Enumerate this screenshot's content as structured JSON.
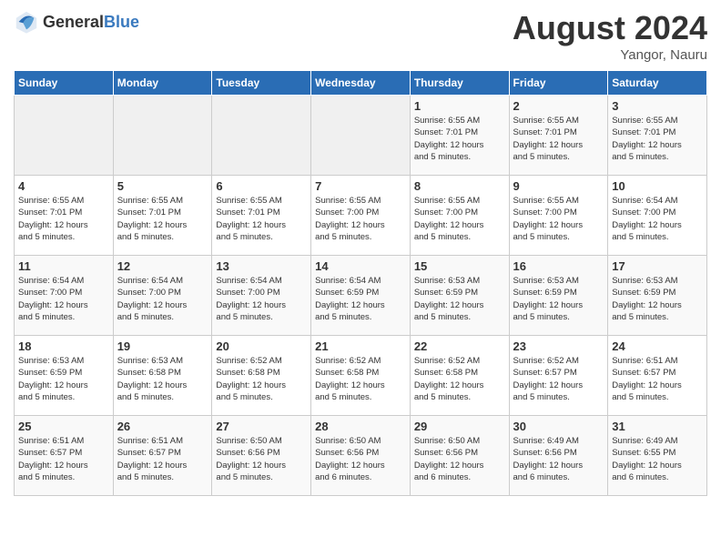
{
  "header": {
    "logo_general": "General",
    "logo_blue": "Blue",
    "month_year": "August 2024",
    "location": "Yangor, Nauru"
  },
  "weekdays": [
    "Sunday",
    "Monday",
    "Tuesday",
    "Wednesday",
    "Thursday",
    "Friday",
    "Saturday"
  ],
  "weeks": [
    [
      {
        "day": "",
        "info": ""
      },
      {
        "day": "",
        "info": ""
      },
      {
        "day": "",
        "info": ""
      },
      {
        "day": "",
        "info": ""
      },
      {
        "day": "1",
        "info": "Sunrise: 6:55 AM\nSunset: 7:01 PM\nDaylight: 12 hours\nand 5 minutes."
      },
      {
        "day": "2",
        "info": "Sunrise: 6:55 AM\nSunset: 7:01 PM\nDaylight: 12 hours\nand 5 minutes."
      },
      {
        "day": "3",
        "info": "Sunrise: 6:55 AM\nSunset: 7:01 PM\nDaylight: 12 hours\nand 5 minutes."
      }
    ],
    [
      {
        "day": "4",
        "info": "Sunrise: 6:55 AM\nSunset: 7:01 PM\nDaylight: 12 hours\nand 5 minutes."
      },
      {
        "day": "5",
        "info": "Sunrise: 6:55 AM\nSunset: 7:01 PM\nDaylight: 12 hours\nand 5 minutes."
      },
      {
        "day": "6",
        "info": "Sunrise: 6:55 AM\nSunset: 7:01 PM\nDaylight: 12 hours\nand 5 minutes."
      },
      {
        "day": "7",
        "info": "Sunrise: 6:55 AM\nSunset: 7:00 PM\nDaylight: 12 hours\nand 5 minutes."
      },
      {
        "day": "8",
        "info": "Sunrise: 6:55 AM\nSunset: 7:00 PM\nDaylight: 12 hours\nand 5 minutes."
      },
      {
        "day": "9",
        "info": "Sunrise: 6:55 AM\nSunset: 7:00 PM\nDaylight: 12 hours\nand 5 minutes."
      },
      {
        "day": "10",
        "info": "Sunrise: 6:54 AM\nSunset: 7:00 PM\nDaylight: 12 hours\nand 5 minutes."
      }
    ],
    [
      {
        "day": "11",
        "info": "Sunrise: 6:54 AM\nSunset: 7:00 PM\nDaylight: 12 hours\nand 5 minutes."
      },
      {
        "day": "12",
        "info": "Sunrise: 6:54 AM\nSunset: 7:00 PM\nDaylight: 12 hours\nand 5 minutes."
      },
      {
        "day": "13",
        "info": "Sunrise: 6:54 AM\nSunset: 7:00 PM\nDaylight: 12 hours\nand 5 minutes."
      },
      {
        "day": "14",
        "info": "Sunrise: 6:54 AM\nSunset: 6:59 PM\nDaylight: 12 hours\nand 5 minutes."
      },
      {
        "day": "15",
        "info": "Sunrise: 6:53 AM\nSunset: 6:59 PM\nDaylight: 12 hours\nand 5 minutes."
      },
      {
        "day": "16",
        "info": "Sunrise: 6:53 AM\nSunset: 6:59 PM\nDaylight: 12 hours\nand 5 minutes."
      },
      {
        "day": "17",
        "info": "Sunrise: 6:53 AM\nSunset: 6:59 PM\nDaylight: 12 hours\nand 5 minutes."
      }
    ],
    [
      {
        "day": "18",
        "info": "Sunrise: 6:53 AM\nSunset: 6:59 PM\nDaylight: 12 hours\nand 5 minutes."
      },
      {
        "day": "19",
        "info": "Sunrise: 6:53 AM\nSunset: 6:58 PM\nDaylight: 12 hours\nand 5 minutes."
      },
      {
        "day": "20",
        "info": "Sunrise: 6:52 AM\nSunset: 6:58 PM\nDaylight: 12 hours\nand 5 minutes."
      },
      {
        "day": "21",
        "info": "Sunrise: 6:52 AM\nSunset: 6:58 PM\nDaylight: 12 hours\nand 5 minutes."
      },
      {
        "day": "22",
        "info": "Sunrise: 6:52 AM\nSunset: 6:58 PM\nDaylight: 12 hours\nand 5 minutes."
      },
      {
        "day": "23",
        "info": "Sunrise: 6:52 AM\nSunset: 6:57 PM\nDaylight: 12 hours\nand 5 minutes."
      },
      {
        "day": "24",
        "info": "Sunrise: 6:51 AM\nSunset: 6:57 PM\nDaylight: 12 hours\nand 5 minutes."
      }
    ],
    [
      {
        "day": "25",
        "info": "Sunrise: 6:51 AM\nSunset: 6:57 PM\nDaylight: 12 hours\nand 5 minutes."
      },
      {
        "day": "26",
        "info": "Sunrise: 6:51 AM\nSunset: 6:57 PM\nDaylight: 12 hours\nand 5 minutes."
      },
      {
        "day": "27",
        "info": "Sunrise: 6:50 AM\nSunset: 6:56 PM\nDaylight: 12 hours\nand 5 minutes."
      },
      {
        "day": "28",
        "info": "Sunrise: 6:50 AM\nSunset: 6:56 PM\nDaylight: 12 hours\nand 6 minutes."
      },
      {
        "day": "29",
        "info": "Sunrise: 6:50 AM\nSunset: 6:56 PM\nDaylight: 12 hours\nand 6 minutes."
      },
      {
        "day": "30",
        "info": "Sunrise: 6:49 AM\nSunset: 6:56 PM\nDaylight: 12 hours\nand 6 minutes."
      },
      {
        "day": "31",
        "info": "Sunrise: 6:49 AM\nSunset: 6:55 PM\nDaylight: 12 hours\nand 6 minutes."
      }
    ]
  ]
}
